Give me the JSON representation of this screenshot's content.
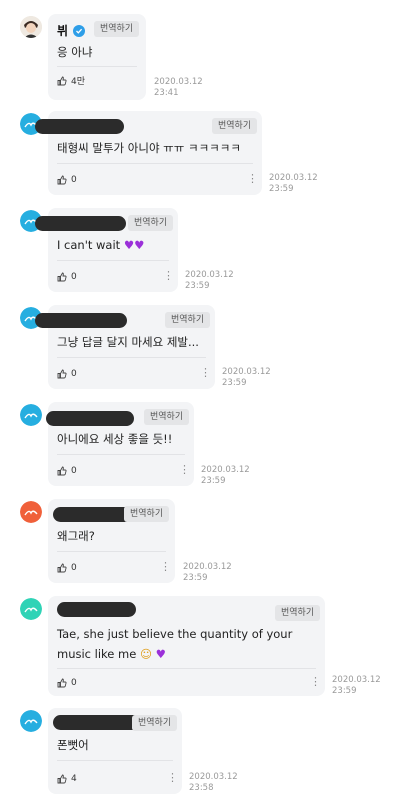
{
  "translate_label": "번역하기",
  "comments": [
    {
      "name": "뷔",
      "verified": true,
      "message": "응 아냐",
      "likes": "4만",
      "date": "2020.03.12",
      "time": "23:41"
    },
    {
      "message": "태형씨 말투가 아니야 ㅠㅠ ㅋㅋㅋㅋㅋ",
      "likes": "0",
      "date": "2020.03.12",
      "time": "23:59"
    },
    {
      "message": "I can't wait",
      "likes": "0",
      "date": "2020.03.12",
      "time": "23:59"
    },
    {
      "message": "그냥 답글 달지 마세요 제발...",
      "likes": "0",
      "date": "2020.03.12",
      "time": "23:59"
    },
    {
      "message": "아니에요 세상 좋을 듯!!",
      "likes": "0",
      "date": "2020.03.12",
      "time": "23:59"
    },
    {
      "message": "왜그래?",
      "likes": "0",
      "date": "2020.03.12",
      "time": "23:59"
    },
    {
      "message_line1": "Tae, she just believe the quantity of your",
      "message_line2": "music like me",
      "likes": "0",
      "date": "2020.03.12",
      "time": "23:59"
    },
    {
      "message": "폰뻣어",
      "likes": "4",
      "date": "2020.03.12",
      "time": "23:58"
    }
  ],
  "icons": {
    "like": "thumbs-up-icon",
    "more": "kebab-menu-icon",
    "verified": "verified-badge-icon",
    "avatar": "avatar-icon"
  },
  "colors": {
    "bubble": "#f3f4f6",
    "verified": "#2e9ee8",
    "redaction": "#2b2b2b",
    "heart_emoji": "#9b30d9"
  }
}
